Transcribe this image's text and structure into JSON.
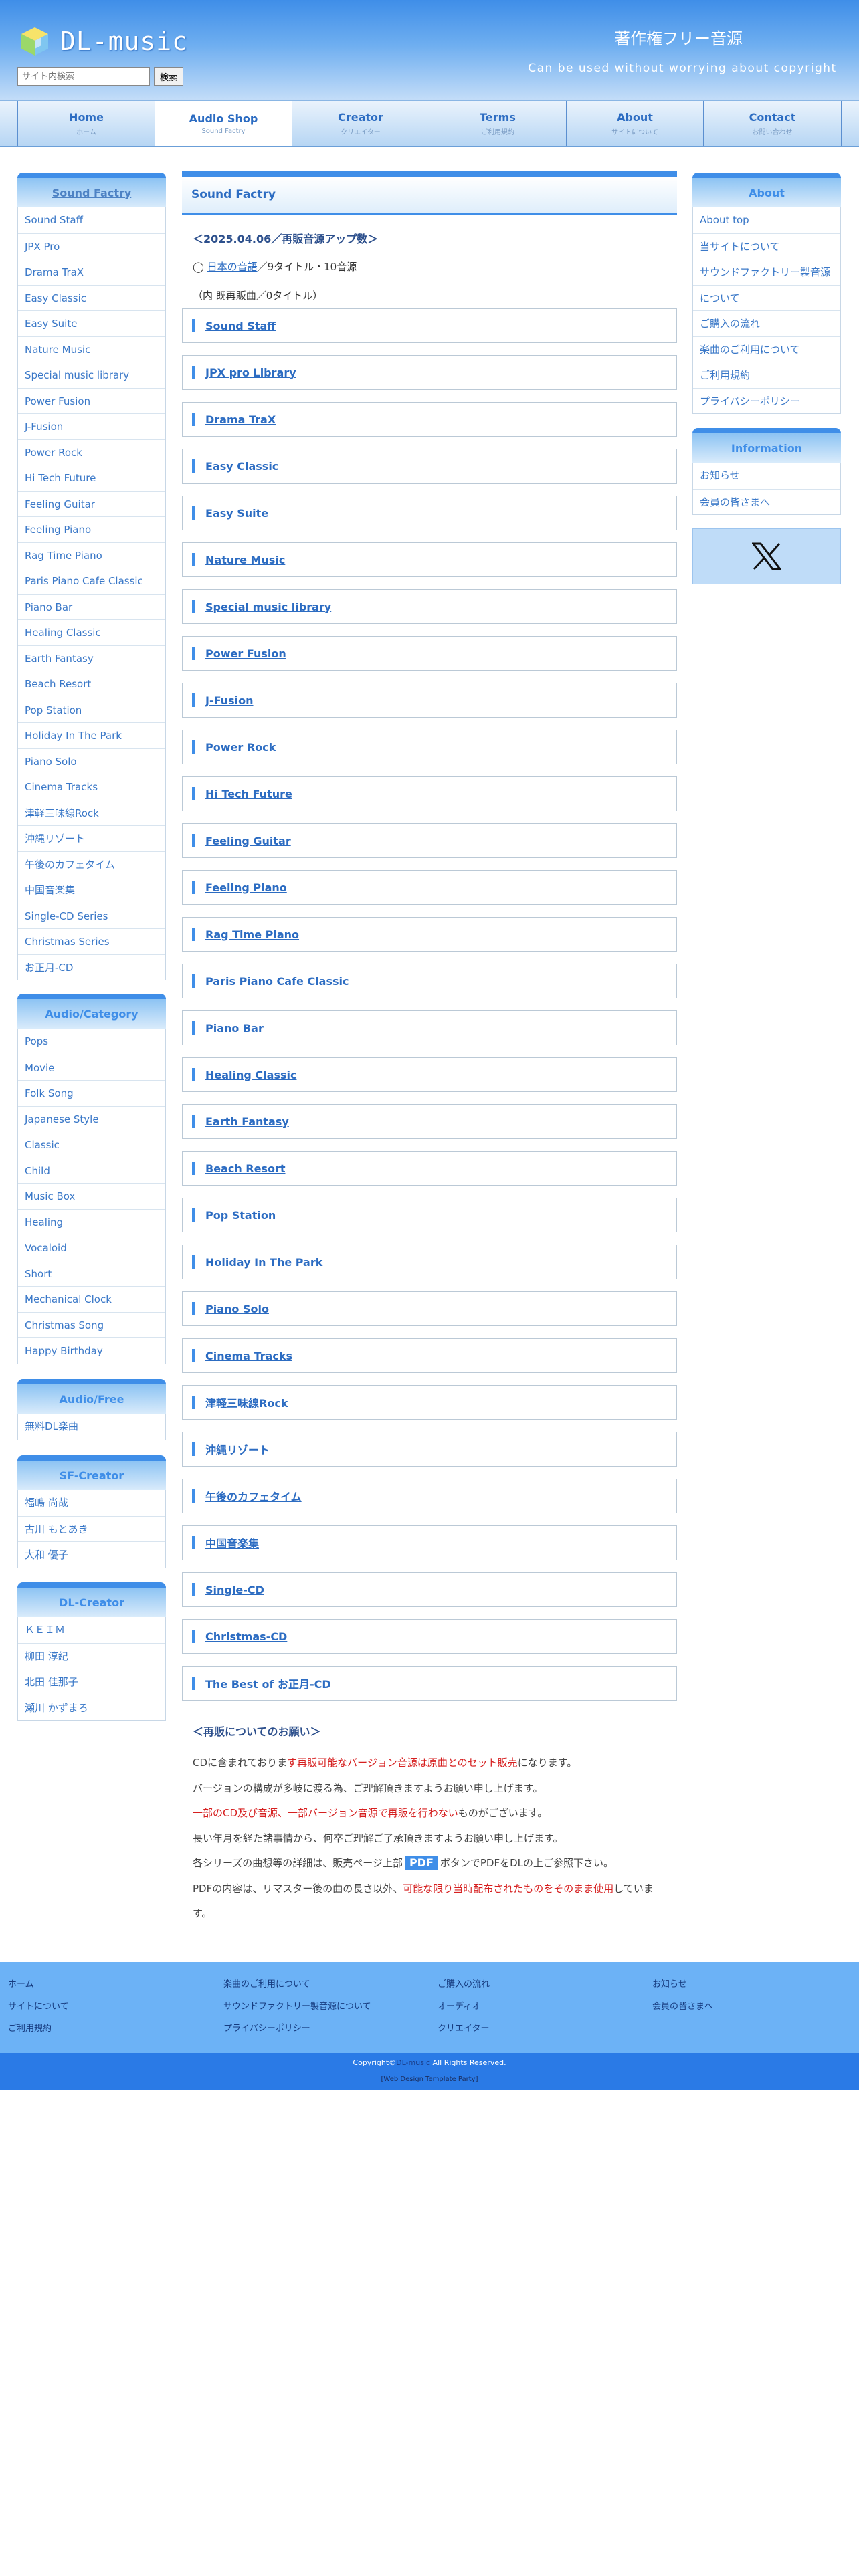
{
  "header": {
    "logo_text": "DL-music",
    "tagline": "著作権フリー音源",
    "subtitle": "Can be used without worrying about copyright",
    "search_placeholder": "サイト内検索",
    "search_button": "検索"
  },
  "nav": [
    {
      "title": "Home",
      "sub": "ホーム"
    },
    {
      "title": "Audio Shop",
      "sub": "Sound Factry"
    },
    {
      "title": "Creator",
      "sub": "クリエイター"
    },
    {
      "title": "Terms",
      "sub": "ご利用規約"
    },
    {
      "title": "About",
      "sub": "サイトについて"
    },
    {
      "title": "Contact",
      "sub": "お問い合わせ"
    }
  ],
  "sidebar_left": {
    "sound_factry": {
      "title": "Sound Factry",
      "items": [
        "Sound Staff",
        "JPX Pro",
        "Drama TraX",
        "Easy Classic",
        "Easy Suite",
        "Nature Music",
        "Special music library",
        "Power Fusion",
        "J-Fusion",
        "Power Rock",
        "Hi Tech Future",
        "Feeling Guitar",
        "Feeling Piano",
        "Rag Time Piano",
        "Paris Piano Cafe Classic",
        "Piano Bar",
        "Healing Classic",
        "Earth Fantasy",
        "Beach Resort",
        "Pop Station",
        "Holiday In The Park",
        "Piano Solo",
        "Cinema Tracks",
        "津軽三味線Rock",
        "沖縄リゾート",
        "午後のカフェタイム",
        "中国音楽集",
        "Single-CD Series",
        "Christmas Series",
        "お正月-CD"
      ]
    },
    "audio_category": {
      "title": "Audio/Category",
      "items": [
        "Pops",
        "Movie",
        "Folk Song",
        "Japanese Style",
        "Classic",
        "Child",
        "Music Box",
        "Healing",
        "Vocaloid",
        "Short",
        "Mechanical Clock",
        "Christmas Song",
        "Happy Birthday"
      ]
    },
    "audio_free": {
      "title": "Audio/Free",
      "items": [
        "無料DL楽曲"
      ]
    },
    "sf_creator": {
      "title": "SF-Creator",
      "items": [
        "福嶋 尚哉",
        "古川 もとあき",
        "大和 優子"
      ]
    },
    "dl_creator": {
      "title": "DL-Creator",
      "items": [
        "ＫＥＩＭ",
        "柳田 淳紀",
        "北田 佳那子",
        "瀬川 かずまろ"
      ]
    }
  },
  "sidebar_right": {
    "about": {
      "title": "About",
      "items": [
        "About top",
        "当サイトについて",
        "サウンドファクトリー製音源",
        "について",
        "ご購入の流れ",
        "楽曲のご利用について",
        "ご利用規約",
        "プライバシーポリシー"
      ]
    },
    "information": {
      "title": "Information",
      "items": [
        "お知らせ",
        "会員の皆さまへ"
      ]
    }
  },
  "content": {
    "title": "Sound Factry",
    "update": "＜2025.04.06／再販音源アップ数＞",
    "news_marker": "◯",
    "news_link": "日本の音語",
    "news_text": "／9タイトル・10音源",
    "news_sub": "（内 既再販曲／0タイトル）",
    "categories": [
      "Sound Staff",
      "JPX pro Library",
      "Drama TraX",
      "Easy Classic",
      "Easy Suite",
      "Nature Music",
      "Special music library",
      "Power Fusion",
      "J-Fusion",
      "Power Rock",
      "Hi Tech Future",
      "Feeling Guitar",
      "Feeling Piano",
      "Rag Time Piano",
      "Paris Piano Cafe Classic",
      "Piano Bar",
      "Healing Classic",
      "Earth Fantasy",
      "Beach Resort",
      "Pop Station",
      "Holiday In The Park",
      "Piano Solo",
      "Cinema Tracks",
      "津軽三味線Rock",
      "沖縄リゾート",
      "午後のカフェタイム",
      "中国音楽集",
      " Single-CD",
      " Christmas-CD",
      " The Best of お正月-CD"
    ],
    "notes_title": "＜再販についてのお願い＞",
    "note1_a": "CDに含まれておりま",
    "note1_red": "す再販可能なバージョン音源は原曲とのセット販売",
    "note1_b": "になります。",
    "note2": "バージョンの構成が多岐に渡る為、ご理解頂きますようお願い申し上げます。",
    "note3_red": "一部のCD及び音源、一部バージョン音源で再販を行わない",
    "note3_b": "ものがございます。",
    "note4": "長い年月を経た諸事情から、何卒ご理解ご了承頂きますようお願い申し上げます。",
    "note5_a": "各シリーズの曲想等の詳細は、販売ページ上部",
    "note5_pdf": "PDF",
    "note5_b": "ボタンでPDFをDLの上ご参照下さい。",
    "note6_a": "PDFの内容は、リマスター後の曲の長さ以外、",
    "note6_red": "可能な限り当時配布されたものをそのまま使用",
    "note6_b": "していま",
    "note6_c": "す。"
  },
  "footer": {
    "columns": [
      [
        "ホーム",
        "サイトについて",
        "ご利用規約"
      ],
      [
        "楽曲のご利用について",
        "サウンドファクトリー製音源について",
        "プライバシーポリシー"
      ],
      [
        "ご購入の流れ",
        "オーディオ",
        "クリエイター"
      ],
      [
        "お知らせ",
        "会員の皆さまへ"
      ]
    ],
    "copyright_a": "Copyright©",
    "copyright_brand": "DL-music",
    "copyright_b": " All Rights Reserved.",
    "credit": "[Web Design Template Party]"
  },
  "colors": {
    "accent": "#3f8ee8",
    "link": "#2c6cc2",
    "red": "#d61f1f",
    "footer": "#6cb2f6",
    "footer_bottom": "#2a7ae6"
  }
}
